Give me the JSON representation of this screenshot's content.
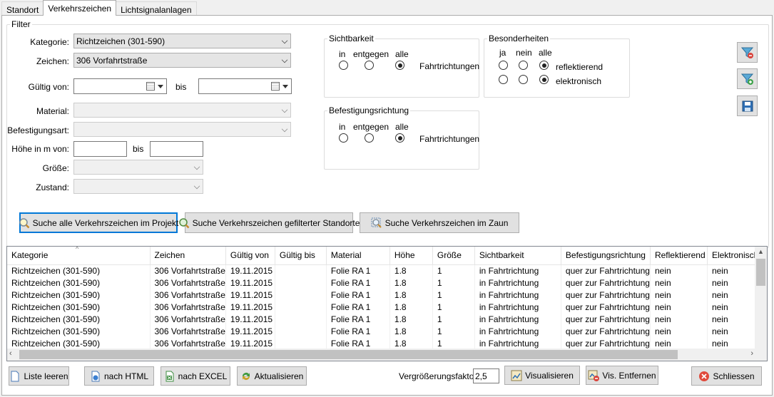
{
  "tabs": [
    {
      "label": "Standort"
    },
    {
      "label": "Verkehrszeichen"
    },
    {
      "label": "Lichtsignalanlagen"
    }
  ],
  "filter": {
    "legend": "Filter",
    "kategorie_label": "Kategorie:",
    "kategorie_value": "Richtzeichen (301-590)",
    "zeichen_label": "Zeichen:",
    "zeichen_value": "306 Vorfahrtstraße",
    "gueltig_von_label": "Gültig von:",
    "bis_label": "bis",
    "material_label": "Material:",
    "befestigungsart_label": "Befestigungsart:",
    "hoehe_label": "Höhe in m von:",
    "hoehe_bis_label": "bis",
    "groesse_label": "Größe:",
    "zustand_label": "Zustand:"
  },
  "sichtbarkeit": {
    "legend": "Sichtbarkeit",
    "opt_in": "in",
    "opt_entgegen": "entgegen",
    "opt_alle": "alle",
    "suffix": "Fahrtrichtungen",
    "selected": "alle"
  },
  "befestigungsrichtung": {
    "legend": "Befestigungsrichtung",
    "opt_in": "in",
    "opt_entgegen": "entgegen",
    "opt_alle": "alle",
    "suffix": "Fahrtrichtungen",
    "selected": "alle"
  },
  "besonderheiten": {
    "legend": "Besonderheiten",
    "opt_ja": "ja",
    "opt_nein": "nein",
    "opt_alle": "alle",
    "row1": "reflektierend",
    "row2": "elektronisch",
    "selected": "alle"
  },
  "search_buttons": {
    "alle": "Suche alle Verkehrszeichen im Projekt",
    "gefiltert": "Suche Verkehrszeichen gefilterter Standorte",
    "zaun": "Suche Verkehrszeichen im Zaun"
  },
  "table": {
    "columns": [
      "Kategorie",
      "Zeichen",
      "Gültig von",
      "Gültig bis",
      "Material",
      "Höhe",
      "Größe",
      "Sichtbarkeit",
      "Befestigungsrichtung",
      "Reflektierend",
      "Elektronisch"
    ],
    "rows": [
      [
        "Richtzeichen (301-590)",
        "306 Vorfahrtstraße",
        "19.11.2015",
        "",
        "Folie RA 1",
        "1.8",
        "1",
        "in Fahrtrichtung",
        "quer zur Fahrtrichtung",
        "nein",
        "nein"
      ],
      [
        "Richtzeichen (301-590)",
        "306 Vorfahrtstraße",
        "19.11.2015",
        "",
        "Folie RA 1",
        "1.8",
        "1",
        "in Fahrtrichtung",
        "quer zur Fahrtrichtung",
        "nein",
        "nein"
      ],
      [
        "Richtzeichen (301-590)",
        "306 Vorfahrtstraße",
        "19.11.2015",
        "",
        "Folie RA 1",
        "1.8",
        "1",
        "in Fahrtrichtung",
        "quer zur Fahrtrichtung",
        "nein",
        "nein"
      ],
      [
        "Richtzeichen (301-590)",
        "306 Vorfahrtstraße",
        "19.11.2015",
        "",
        "Folie RA 1",
        "1.8",
        "1",
        "in Fahrtrichtung",
        "quer zur Fahrtrichtung",
        "nein",
        "nein"
      ],
      [
        "Richtzeichen (301-590)",
        "306 Vorfahrtstraße",
        "19.11.2015",
        "",
        "Folie RA 1",
        "1.8",
        "1",
        "in Fahrtrichtung",
        "quer zur Fahrtrichtung",
        "nein",
        "nein"
      ],
      [
        "Richtzeichen (301-590)",
        "306 Vorfahrtstraße",
        "19.11.2015",
        "",
        "Folie RA 1",
        "1.8",
        "1",
        "in Fahrtrichtung",
        "quer zur Fahrtrichtung",
        "nein",
        "nein"
      ],
      [
        "Richtzeichen (301-590)",
        "306 Vorfahrtstraße",
        "19.11.2015",
        "",
        "Folie RA 1",
        "1.8",
        "1",
        "in Fahrtrichtung",
        "quer zur Fahrtrichtung",
        "nein",
        "nein"
      ]
    ]
  },
  "bottom": {
    "liste_leeren": "Liste leeren",
    "nach_html": "nach HTML",
    "nach_excel": "nach EXCEL",
    "aktualisieren": "Aktualisieren",
    "zoom_label": "Vergrößerungsfaktor",
    "zoom_value": "2,5",
    "visualisieren": "Visualisieren",
    "vis_entfernen": "Vis. Entfernen",
    "schliessen": "Schliessen"
  }
}
